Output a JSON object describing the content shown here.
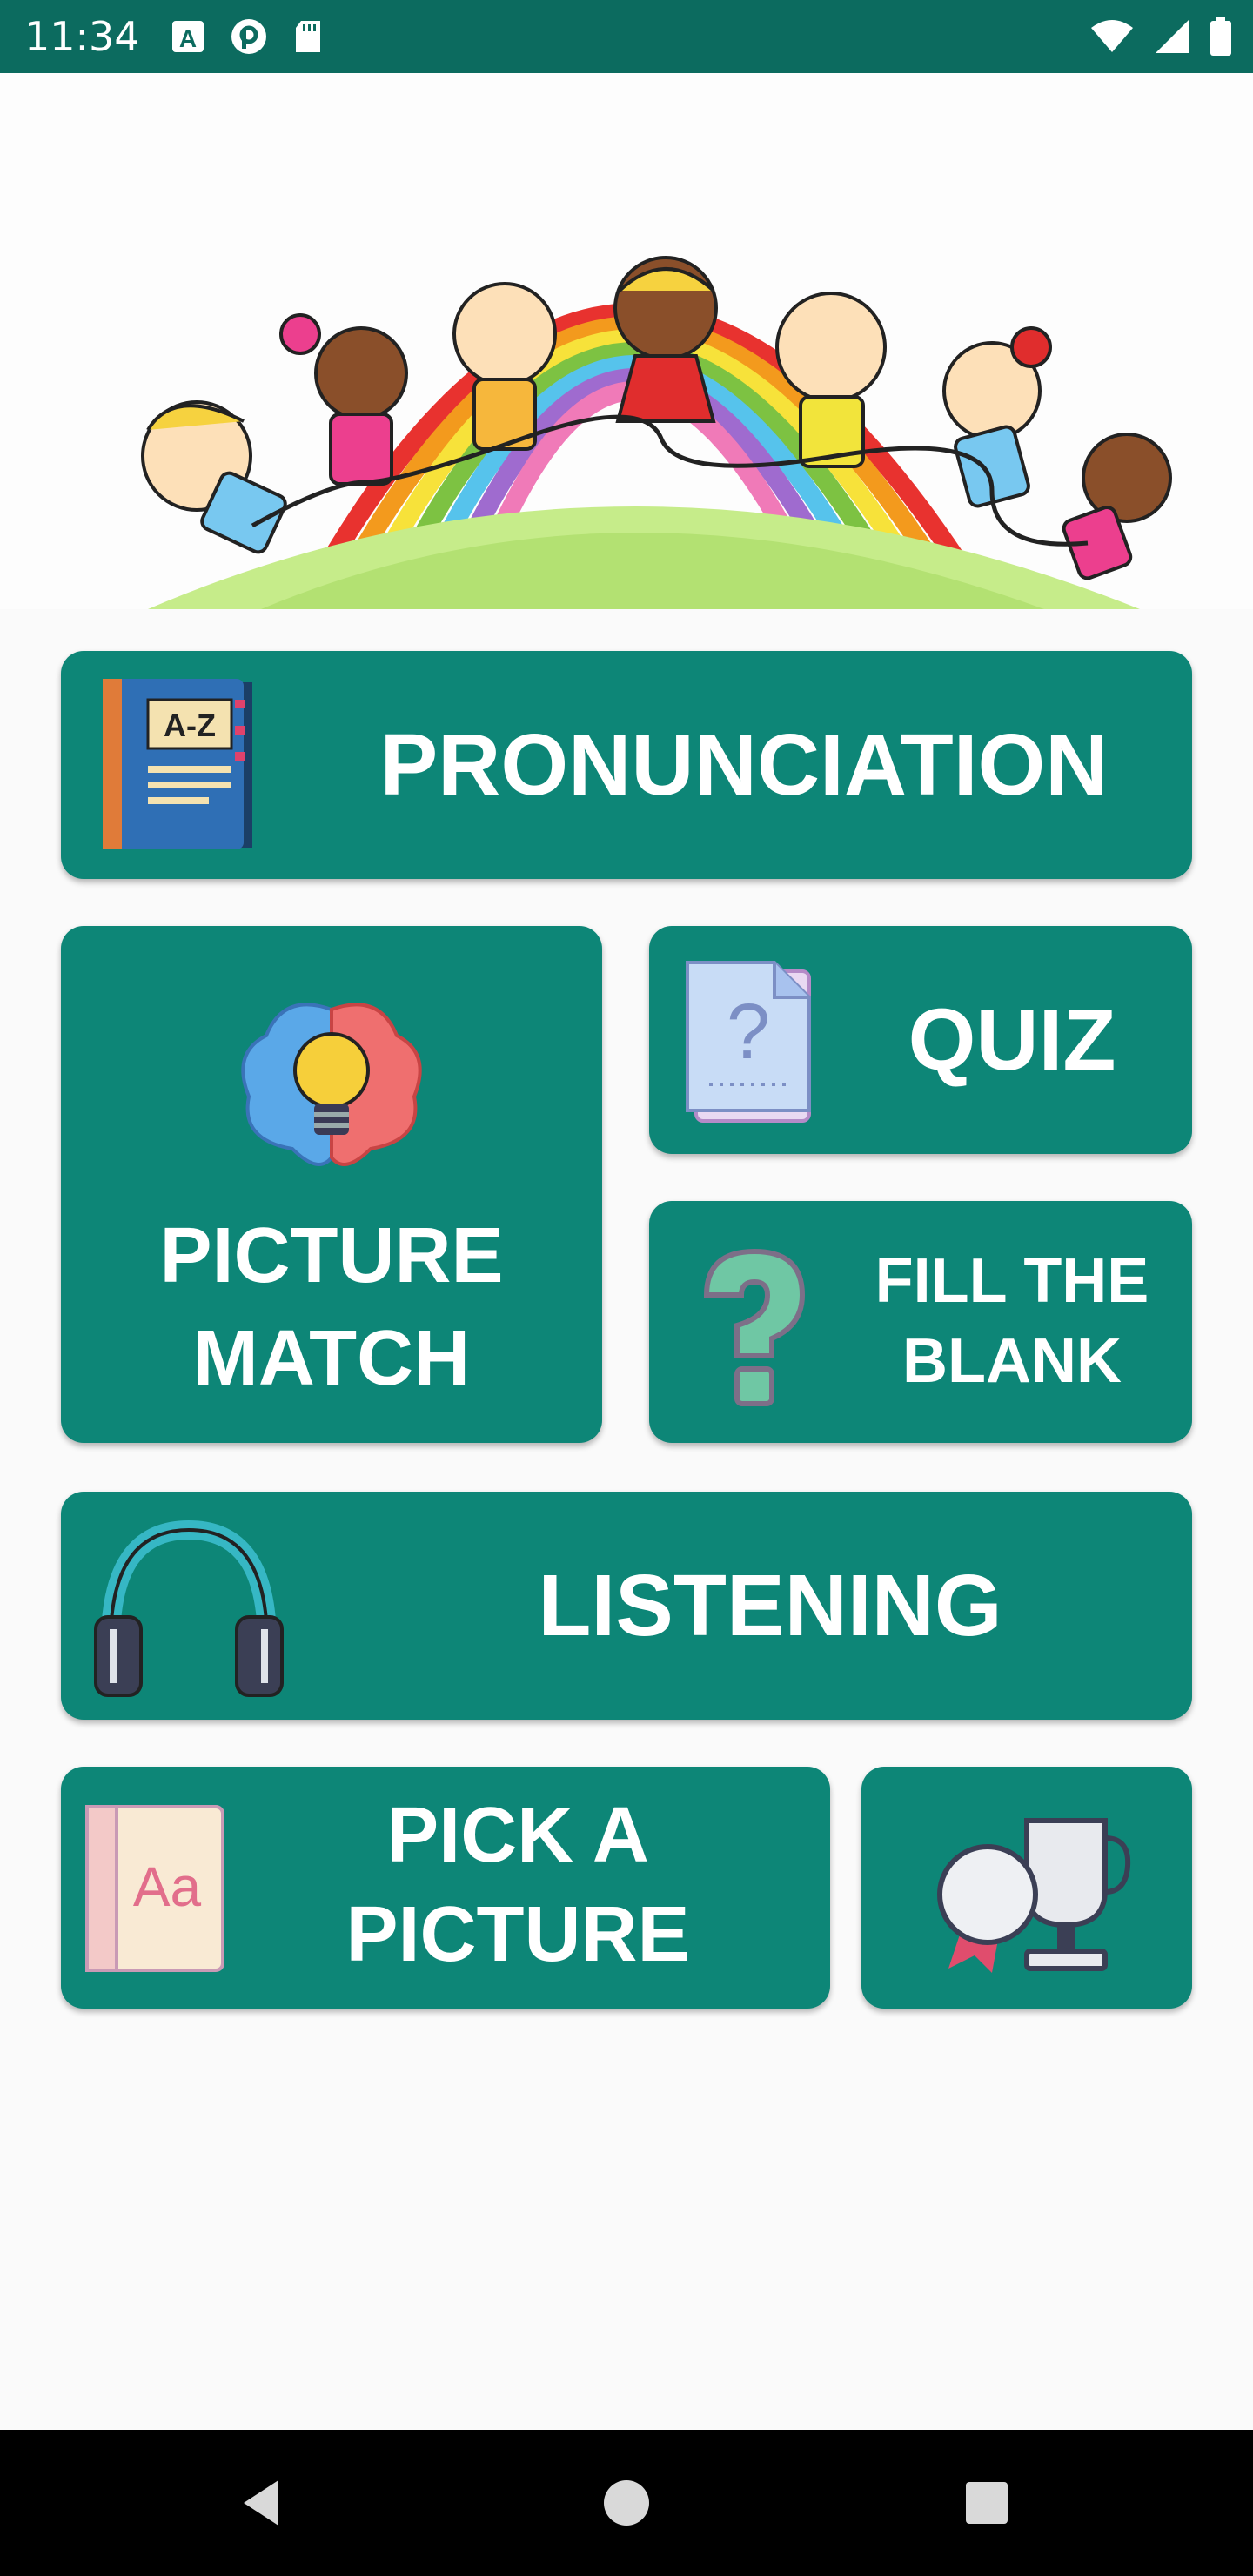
{
  "status_bar": {
    "time": "11:34",
    "left_icons": [
      "a-notification-icon",
      "p-notification-icon",
      "sd-card-icon"
    ],
    "right_icons": [
      "wifi-icon",
      "cell-signal-icon",
      "battery-icon"
    ]
  },
  "hero": {
    "image": "rainbow-children-illustration"
  },
  "tiles": {
    "pronunciation": {
      "label": "PRONUNCIATION",
      "icon": "a-z-book-icon"
    },
    "picture_match": {
      "label_line1": "PICTURE",
      "label_line2": "MATCH",
      "icon": "brain-bulb-icon"
    },
    "quiz": {
      "label": "QUIZ",
      "icon": "question-paper-icon"
    },
    "fill_blank": {
      "label_line1": "FILL THE",
      "label_line2": "BLANK",
      "icon": "question-mark-icon"
    },
    "listening": {
      "label": "LISTENING",
      "icon": "headphones-icon"
    },
    "pick_picture": {
      "label_line1": "PICK A",
      "label_line2": "PICTURE",
      "icon": "dictionary-aa-icon"
    },
    "awards": {
      "icon": "trophy-medal-icon"
    }
  },
  "nav_bar": {
    "buttons": [
      "back-triangle-icon",
      "home-circle-icon",
      "recents-square-icon"
    ]
  },
  "colors": {
    "status_bar": "#0c6b5f",
    "tile": "#0d8677",
    "background": "#fafafa"
  }
}
